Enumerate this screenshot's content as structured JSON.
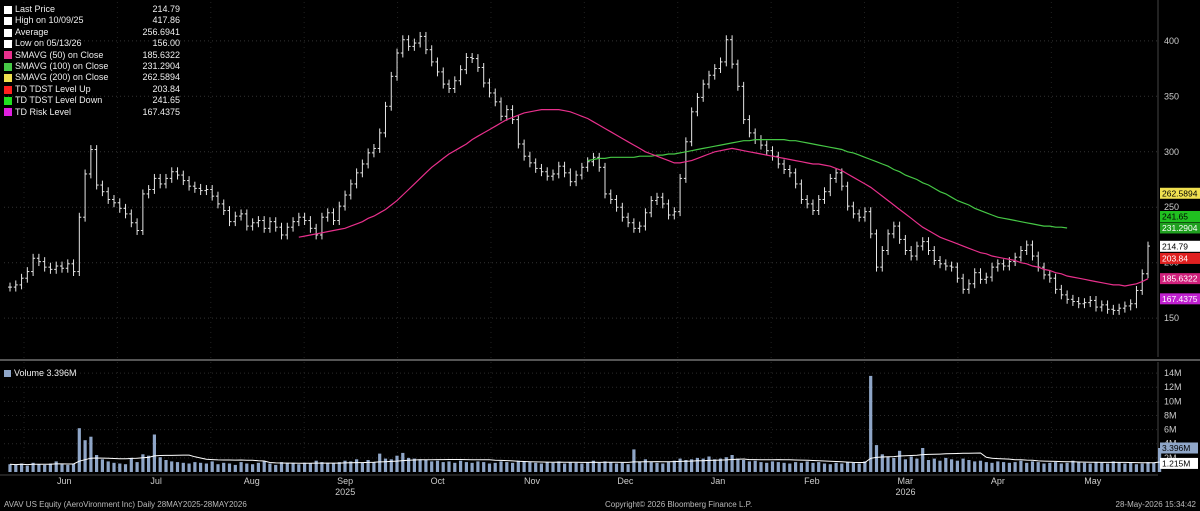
{
  "legend": [
    {
      "label": "Last Price",
      "value": "214.79",
      "color": "#ffffff"
    },
    {
      "label": "High on 10/09/25",
      "value": "417.86",
      "color": "#ffffff"
    },
    {
      "label": "Average",
      "value": "256.6941",
      "color": "#ffffff"
    },
    {
      "label": "Low on 05/13/26",
      "value": "156.00",
      "color": "#ffffff"
    },
    {
      "label": "SMAVG (50)  on Close",
      "value": "185.6322",
      "color": "#e8308c"
    },
    {
      "label": "SMAVG (100)  on Close",
      "value": "231.2904",
      "color": "#46c846"
    },
    {
      "label": "SMAVG (200)  on Close",
      "value": "262.5894",
      "color": "#f0e050"
    },
    {
      "label": "TD TDST Level Up",
      "value": "203.84",
      "color": "#ff2020"
    },
    {
      "label": "TD TDST Level Down",
      "value": "241.65",
      "color": "#20e020"
    },
    {
      "label": "TD Risk Level",
      "value": "167.4375",
      "color": "#e020e0"
    }
  ],
  "volume_legend": "Volume 3.396M",
  "footer": {
    "left": "AVAV US Equity (AeroVironment Inc) Daily 28MAY2025-28MAY2026",
    "center": "Copyright© 2026 Bloomberg Finance L.P.",
    "right": "28-May-2026 15:34:42"
  },
  "chart_data": {
    "type": "line",
    "price": {
      "ylim": [
        115,
        435
      ],
      "yticks": [
        150,
        200,
        250,
        300,
        350,
        400
      ],
      "months": [
        "Jun",
        "Jul",
        "Aug",
        "Sep",
        "Oct",
        "Nov",
        "Dec",
        "Jan",
        "Feb",
        "Mar",
        "Apr",
        "May"
      ],
      "years": [
        {
          "label": "2025",
          "under": "Sep"
        },
        {
          "label": "2026",
          "under": "Mar"
        }
      ],
      "close": [
        178,
        180,
        186,
        192,
        204,
        201,
        196,
        194,
        197,
        195,
        199,
        192,
        241,
        280,
        302,
        270,
        264,
        257,
        254,
        249,
        244,
        236,
        229,
        262,
        266,
        276,
        271,
        276,
        282,
        279,
        274,
        269,
        267,
        265,
        266,
        260,
        253,
        247,
        237,
        242,
        244,
        233,
        236,
        238,
        231,
        237,
        232,
        225,
        232,
        237,
        241,
        238,
        231,
        225,
        241,
        245,
        238,
        251,
        261,
        271,
        281,
        289,
        299,
        303,
        317,
        341,
        368,
        389,
        401,
        395,
        398,
        404,
        392,
        381,
        372,
        361,
        357,
        364,
        374,
        385,
        384,
        376,
        362,
        353,
        345,
        332,
        338,
        329,
        307,
        296,
        290,
        285,
        282,
        278,
        280,
        287,
        281,
        273,
        279,
        286,
        291,
        295,
        286,
        262,
        257,
        250,
        241,
        236,
        231,
        233,
        245,
        256,
        259,
        253,
        243,
        246,
        276,
        309,
        336,
        349,
        361,
        369,
        375,
        381,
        401,
        379,
        359,
        329,
        317,
        311,
        306,
        301,
        296,
        289,
        284,
        281,
        271,
        257,
        253,
        247,
        257,
        264,
        276,
        281,
        269,
        251,
        244,
        241,
        246,
        226,
        196,
        211,
        226,
        233,
        221,
        211,
        206,
        215,
        219,
        211,
        202,
        199,
        197,
        196,
        186,
        176,
        181,
        191,
        185,
        187,
        196,
        199,
        197,
        201,
        205,
        211,
        216,
        206,
        196,
        189,
        186,
        176,
        171,
        167,
        165,
        163,
        164,
        166,
        160,
        162,
        158,
        157,
        159,
        161,
        163,
        175,
        190,
        215
      ],
      "sma50": [
        null,
        null,
        null,
        null,
        null,
        null,
        null,
        null,
        null,
        null,
        null,
        null,
        null,
        null,
        null,
        null,
        null,
        null,
        null,
        null,
        null,
        null,
        null,
        null,
        null,
        null,
        null,
        null,
        null,
        null,
        null,
        null,
        null,
        null,
        null,
        null,
        null,
        null,
        null,
        null,
        null,
        null,
        null,
        null,
        null,
        null,
        null,
        null,
        null,
        null,
        223,
        224,
        225,
        226,
        227,
        228,
        229,
        230,
        231,
        233,
        235,
        237,
        240,
        242,
        245,
        248,
        252,
        256,
        261,
        266,
        271,
        276,
        281,
        286,
        290,
        294,
        298,
        301,
        304,
        307,
        311,
        314,
        317,
        320,
        323,
        326,
        329,
        331,
        333,
        335,
        336,
        337,
        338,
        338,
        338,
        338,
        337,
        336,
        334,
        332,
        330,
        327,
        324,
        321,
        318,
        315,
        312,
        309,
        306,
        303,
        300,
        298,
        296,
        294,
        292,
        290,
        290,
        291,
        292,
        294,
        296,
        298,
        300,
        301,
        302,
        303,
        302,
        301,
        300,
        299,
        298,
        297,
        296,
        295,
        294,
        293,
        292,
        291,
        290,
        289,
        289,
        288,
        287,
        285,
        283,
        280,
        277,
        274,
        271,
        268,
        264,
        260,
        256,
        252,
        248,
        244,
        240,
        236,
        232,
        229,
        226,
        223,
        221,
        219,
        217,
        215,
        213,
        211,
        209,
        208,
        206,
        205,
        204,
        203,
        202,
        200,
        199,
        197,
        196,
        194,
        193,
        191,
        190,
        188,
        187,
        186,
        185,
        184,
        183,
        182,
        181,
        180,
        180,
        179,
        180,
        181,
        183,
        185.6
      ],
      "sma100": [
        null,
        null,
        null,
        null,
        null,
        null,
        null,
        null,
        null,
        null,
        null,
        null,
        null,
        null,
        null,
        null,
        null,
        null,
        null,
        null,
        null,
        null,
        null,
        null,
        null,
        null,
        null,
        null,
        null,
        null,
        null,
        null,
        null,
        null,
        null,
        null,
        null,
        null,
        null,
        null,
        null,
        null,
        null,
        null,
        null,
        null,
        null,
        null,
        null,
        null,
        null,
        null,
        null,
        null,
        null,
        null,
        null,
        null,
        null,
        null,
        null,
        null,
        null,
        null,
        null,
        null,
        null,
        null,
        null,
        null,
        null,
        null,
        null,
        null,
        null,
        null,
        null,
        null,
        null,
        null,
        null,
        null,
        null,
        null,
        null,
        null,
        null,
        null,
        null,
        null,
        null,
        null,
        null,
        null,
        null,
        null,
        null,
        null,
        null,
        null,
        292,
        293,
        294,
        294,
        295,
        295,
        295,
        295,
        295,
        296,
        296,
        296,
        297,
        297,
        298,
        298,
        299,
        300,
        301,
        302,
        303,
        304,
        305,
        306,
        307,
        308,
        309,
        310,
        310,
        311,
        311,
        311,
        311,
        311,
        311,
        310,
        310,
        309,
        308,
        307,
        306,
        305,
        304,
        303,
        302,
        300,
        299,
        297,
        295,
        293,
        291,
        289,
        287,
        284,
        282,
        279,
        277,
        275,
        272,
        270,
        267,
        264,
        262,
        259,
        256,
        254,
        252,
        249,
        247,
        245,
        243,
        241,
        240,
        239,
        238,
        237,
        236,
        235,
        234,
        233,
        233,
        232,
        232,
        231.3
      ],
      "sma200": [
        null,
        null,
        null,
        null,
        null,
        null,
        null,
        null,
        null,
        null,
        null,
        null,
        null,
        null,
        null,
        null,
        null,
        null,
        null,
        null,
        null,
        null,
        null,
        null,
        null,
        null,
        null,
        null,
        null,
        null,
        null,
        null,
        null,
        null,
        null,
        null,
        null,
        null,
        null,
        null,
        null,
        null,
        null,
        null,
        null,
        null,
        null,
        null,
        null,
        null,
        null,
        null,
        null,
        null,
        null,
        null,
        null,
        null,
        null,
        null,
        null,
        null,
        null,
        null,
        null,
        null,
        null,
        null,
        null,
        null,
        null,
        null,
        null,
        null,
        null,
        null,
        null,
        null,
        null,
        null,
        null,
        null,
        null,
        null,
        null,
        null,
        null,
        null,
        null,
        null,
        null,
        null,
        null,
        null,
        null,
        null,
        null,
        null,
        null,
        null,
        null,
        null,
        null,
        null,
        null,
        null,
        null,
        null,
        null,
        null,
        null,
        null,
        null,
        null,
        null,
        null,
        null,
        null,
        null,
        null,
        null,
        null,
        null,
        null,
        null,
        null,
        null,
        null,
        null,
        null,
        null,
        null,
        null,
        null,
        null,
        null,
        null,
        null,
        null,
        null,
        null,
        null,
        null,
        null,
        null,
        null,
        null,
        null,
        null,
        null,
        null,
        null,
        null,
        null,
        null,
        null,
        null,
        null,
        null,
        null,
        null,
        null,
        null,
        null,
        null,
        null,
        null,
        null,
        null,
        null,
        null,
        null,
        null,
        null,
        null,
        null,
        null,
        null,
        null,
        null,
        null,
        null,
        null,
        null,
        null,
        null,
        null,
        null,
        null,
        null,
        null,
        null,
        null,
        null,
        null,
        null,
        null,
        null,
        null,
        null,
        null,
        null,
        null,
        null,
        null,
        null,
        null,
        null,
        null,
        null,
        null,
        null,
        null,
        null,
        null,
        null,
        262.6
      ],
      "labels": [
        {
          "text": "214.79",
          "value": 214.79,
          "bg": "#ffffff",
          "fg": "#000000"
        },
        {
          "text": "203.84",
          "value": 203.84,
          "bg": "#e02020",
          "fg": "#ffffff"
        },
        {
          "text": "185.6322",
          "value": 185.6322,
          "bg": "#d0207c",
          "fg": "#ffffff"
        },
        {
          "text": "167.4375",
          "value": 167.4375,
          "bg": "#c020d0",
          "fg": "#ffffff"
        },
        {
          "text": "262.5894",
          "value": 262.5894,
          "bg": "#f0e050",
          "fg": "#000000"
        },
        {
          "text": "241.65",
          "value": 241.65,
          "bg": "#20c020",
          "fg": "#000000"
        },
        {
          "text": "231.2904",
          "value": 231.2904,
          "bg": "#20a020",
          "fg": "#ffffff"
        }
      ]
    },
    "volume": {
      "ylim": [
        0,
        15
      ],
      "yticks": [
        2,
        4,
        6,
        8,
        10,
        12,
        14
      ],
      "ytick_labels": [
        "2M",
        "4M",
        "6M",
        "8M",
        "10M",
        "12M",
        "14M"
      ],
      "labels": [
        {
          "text": "3.396M",
          "value": 3.396,
          "bg": "#8fa6c8",
          "fg": "#000000"
        },
        {
          "text": "1.215M",
          "value": 1.215,
          "bg": "#ffffff",
          "fg": "#000000"
        }
      ],
      "values": [
        1.1,
        1.0,
        1.2,
        0.9,
        1.3,
        1.1,
        1.0,
        1.2,
        1.5,
        1.1,
        1.0,
        1.2,
        6.2,
        4.5,
        5.0,
        2.4,
        1.8,
        1.5,
        1.3,
        1.2,
        1.1,
        2.0,
        1.4,
        2.5,
        2.3,
        5.3,
        2.1,
        1.7,
        1.5,
        1.4,
        1.3,
        1.2,
        1.4,
        1.3,
        1.2,
        1.5,
        1.1,
        1.3,
        1.2,
        1.0,
        1.4,
        1.2,
        1.1,
        1.3,
        1.5,
        1.2,
        1.0,
        1.4,
        1.3,
        1.2,
        1.1,
        1.3,
        1.2,
        1.6,
        1.4,
        1.3,
        1.2,
        1.4,
        1.6,
        1.5,
        1.8,
        1.3,
        1.7,
        1.4,
        2.6,
        1.9,
        1.8,
        2.3,
        2.7,
        2.0,
        1.9,
        1.8,
        1.7,
        1.5,
        1.6,
        1.4,
        1.5,
        1.3,
        1.6,
        1.4,
        1.3,
        1.5,
        1.4,
        1.2,
        1.3,
        1.5,
        1.4,
        1.3,
        1.6,
        1.5,
        1.4,
        1.3,
        1.2,
        1.4,
        1.3,
        1.5,
        1.2,
        1.4,
        1.3,
        1.2,
        1.4,
        1.6,
        1.3,
        1.5,
        1.4,
        1.2,
        1.3,
        1.1,
        3.2,
        1.5,
        1.8,
        1.4,
        1.3,
        1.2,
        1.4,
        1.6,
        1.9,
        1.7,
        1.8,
        2.0,
        1.9,
        2.2,
        1.8,
        1.9,
        2.1,
        2.4,
        1.9,
        1.7,
        1.5,
        1.6,
        1.4,
        1.3,
        1.5,
        1.4,
        1.3,
        1.2,
        1.4,
        1.3,
        1.5,
        1.3,
        1.4,
        1.2,
        1.1,
        1.3,
        1.2,
        1.4,
        1.3,
        1.2,
        1.5,
        13.6,
        3.8,
        2.5,
        2.2,
        2.0,
        3.0,
        1.8,
        2.2,
        1.9,
        3.4,
        1.7,
        1.9,
        1.6,
        2.0,
        1.8,
        1.6,
        1.9,
        1.7,
        1.5,
        1.6,
        1.4,
        1.3,
        1.5,
        1.4,
        1.3,
        1.4,
        1.6,
        1.3,
        1.5,
        1.4,
        1.2,
        1.3,
        1.4,
        1.2,
        1.3,
        1.6,
        1.4,
        1.3,
        1.2,
        1.4,
        1.3,
        1.2,
        1.5,
        1.4,
        1.2,
        1.3,
        1.1,
        1.2,
        1.4,
        1.3,
        3.4
      ]
    }
  }
}
